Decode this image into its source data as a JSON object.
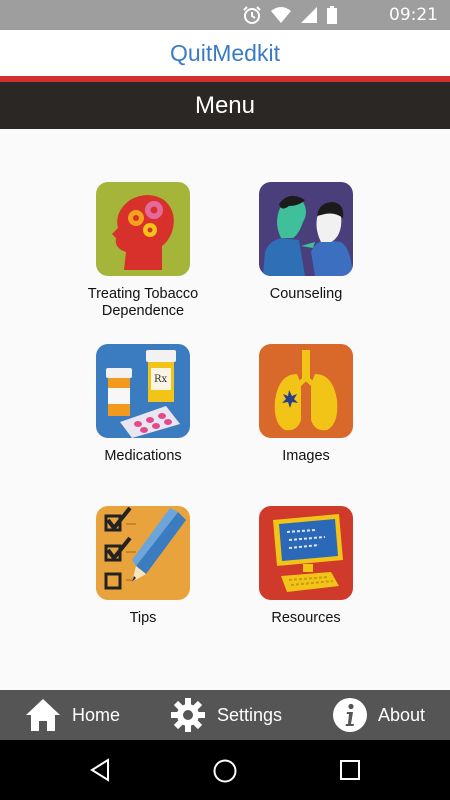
{
  "status_bar": {
    "time": "09:21",
    "icons": [
      "alarm-icon",
      "wifi-icon",
      "cell-signal-icon",
      "battery-icon"
    ]
  },
  "app": {
    "title": "QuitMedkit"
  },
  "menu_bar": {
    "title": "Menu"
  },
  "menu": {
    "items": [
      {
        "label": "Treating Tobacco\nDependence",
        "icon": "brain-gears-icon",
        "color": "#a4b53a"
      },
      {
        "label": "Counseling",
        "icon": "counseling-people-icon",
        "color": "#4a3f7a"
      },
      {
        "label": "Medications",
        "icon": "medication-bottles-icon",
        "color": "#3b7bbf"
      },
      {
        "label": "Images",
        "icon": "lungs-icon",
        "color": "#d9692b"
      },
      {
        "label": "Tips",
        "icon": "checklist-pencil-icon",
        "color": "#e8a33d"
      },
      {
        "label": "Resources",
        "icon": "computer-icon",
        "color": "#cf3a2b"
      }
    ]
  },
  "bottom_nav": {
    "home": "Home",
    "settings": "Settings",
    "about": "About"
  },
  "system_nav": {
    "icons": [
      "back-icon",
      "home-circle-icon",
      "recents-icon"
    ]
  },
  "colors": {
    "title_blue": "#3a7cc4",
    "accent_red": "#d32f2f",
    "menu_bar_bg": "#2b2725",
    "bottom_nav_bg": "#565556"
  }
}
